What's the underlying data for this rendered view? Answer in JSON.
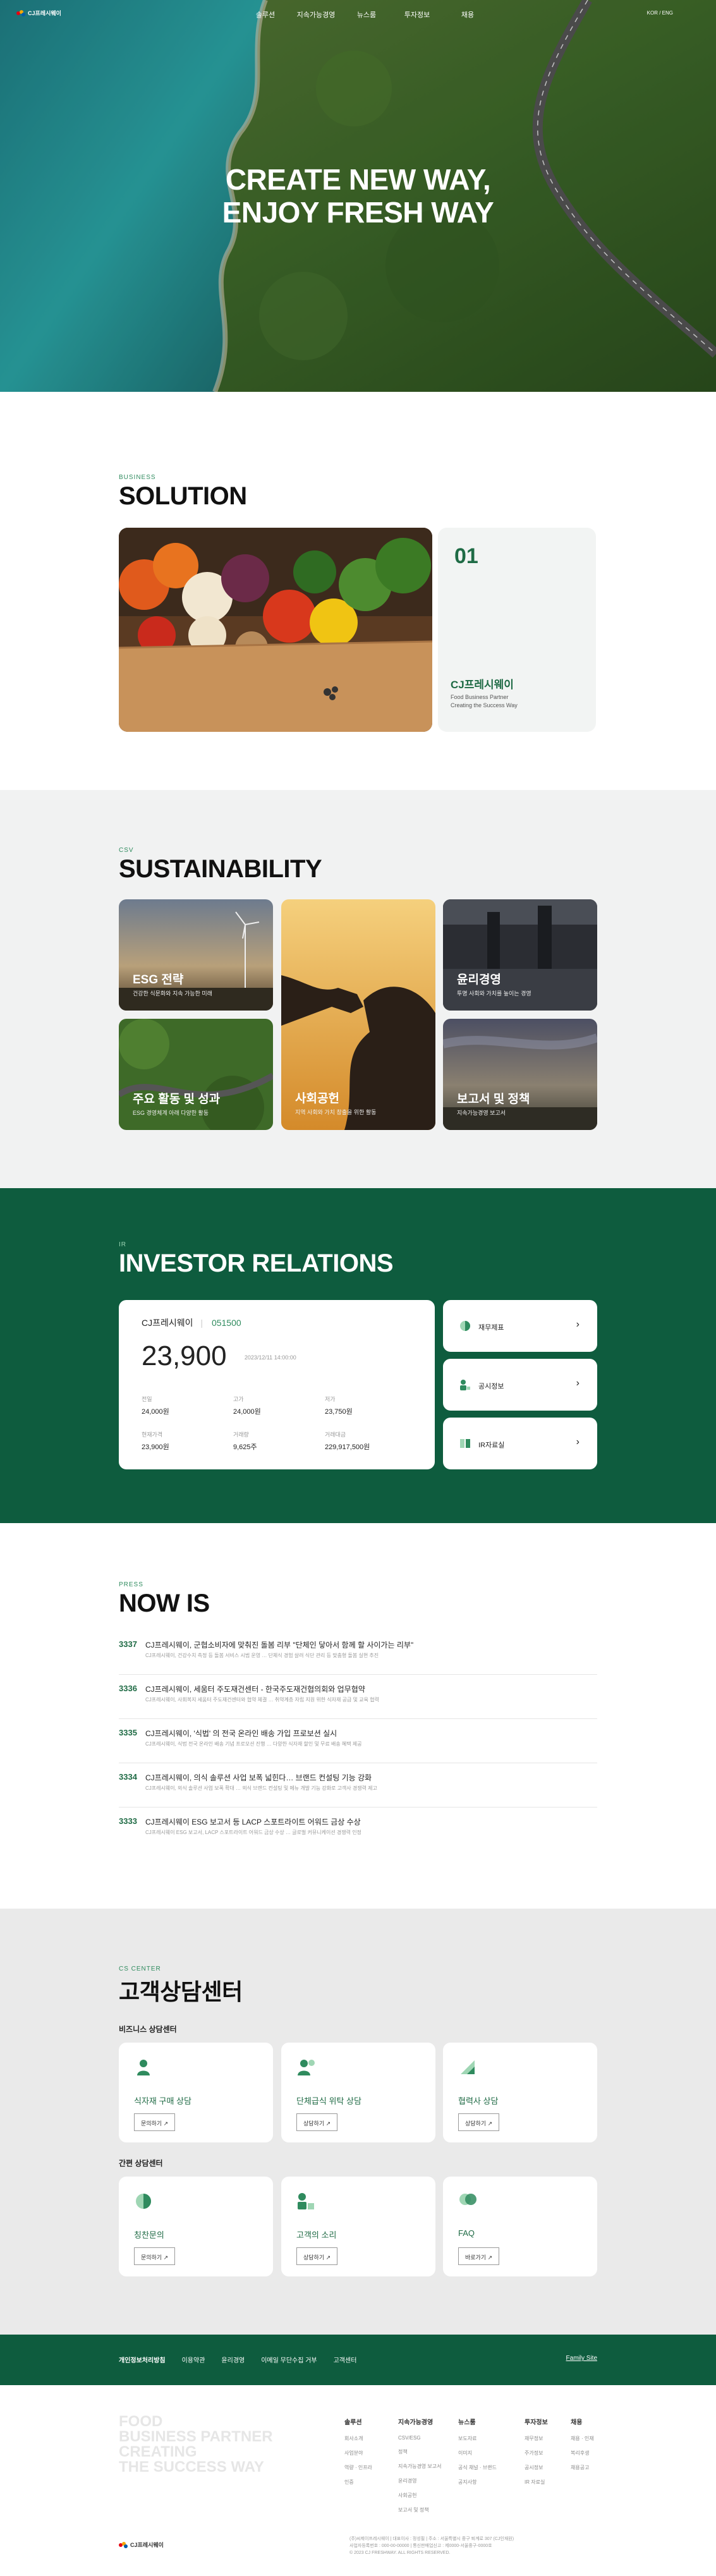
{
  "header": {
    "logo_text": "CJ프레시웨이",
    "nav": [
      "솔루션",
      "지속가능경영",
      "뉴스룸",
      "투자정보",
      "채용"
    ],
    "lang": "KOR / ENG"
  },
  "hero": {
    "line1": "CREATE NEW WAY,",
    "line2": "ENJOY FRESH WAY"
  },
  "solution": {
    "label": "BUSINESS",
    "title": "SOLUTION",
    "card": {
      "num": "01",
      "name": "CJ프레시웨이",
      "desc1": "Food Business Partner",
      "desc2": "Creating the Success Way"
    }
  },
  "sustainability": {
    "label": "CSV",
    "title": "SUSTAINABILITY",
    "tiles": [
      {
        "title": "ESG 전략",
        "desc": "건강한 식문화와 지속 가능한 미래"
      },
      {
        "title": "주요 활동 및 성과",
        "desc": "ESG 경영체계 아래 다양한 활동"
      },
      {
        "title": "사회공헌",
        "desc": "지역 사회와 가치 창출을 위한 활동"
      },
      {
        "title": "윤리경영",
        "desc": "투명 사회와 가치를 높이는 경영"
      },
      {
        "title": "보고서 및 정책",
        "desc": "지속가능경영 보고서"
      }
    ]
  },
  "investor": {
    "label": "IR",
    "title": "INVESTOR RELATIONS",
    "stock": {
      "name": "CJ프레시웨이",
      "code": "051500",
      "price": "23,900",
      "date": "2023/12/11 14:00:00",
      "cells": [
        {
          "k": "전일",
          "v": "24,000원"
        },
        {
          "k": "고가",
          "v": "24,000원"
        },
        {
          "k": "저가",
          "v": "23,750원"
        },
        {
          "k": "현재가격",
          "v": "23,900원"
        },
        {
          "k": "거래량",
          "v": "9,625주"
        },
        {
          "k": "거래대금",
          "v": "229,917,500원"
        }
      ]
    },
    "buttons": [
      "재무제표",
      "공시정보",
      "IR자료실"
    ]
  },
  "news": {
    "label": "PRESS",
    "title": "NOW IS",
    "rows": [
      {
        "no": "3337",
        "title": "CJ프레시웨이, 군협소비자에 맞춰진 돌봄 리부 \"단체인 닿아서 함께 할 사이가는 리부\"",
        "sub": "CJ프레시웨이, 건강수치 측정 등 돌봄 서비스 시범 운영 … 단체식 경험 살려 식단 관리 등 맞춤형 돌봄 실현 추진"
      },
      {
        "no": "3336",
        "title": "CJ프레시웨이, 세움터 주도재건센터 - 한국주도재건협의회와 업무협약",
        "sub": "CJ프레시웨이, 사회복지 세움터 주도재건센터와 협약 체결 … 취약계층 자립 지원 위한 식자재 공급 및 교육 협력"
      },
      {
        "no": "3335",
        "title": "CJ프레시웨이, '식법' 의 전국 온라인 배송 가입 프로보션 실시",
        "sub": "CJ프레시웨이, 식법 전국 온라인 배송 기념 프로모션 진행 … 다양한 식자재 할인 및 무료 배송 혜택 제공"
      },
      {
        "no": "3334",
        "title": "CJ프레시웨이, 의식 솔루션 사업 보폭 넓힌다… 브랜드 컨설팅 기능 강화",
        "sub": "CJ프레시웨이, 외식 솔루션 사업 보폭 확대 … 외식 브랜드 컨설팅 및 메뉴 개발 기능 강화로 고객사 경쟁력 제고"
      },
      {
        "no": "3333",
        "title": "CJ프레시웨이 ESG 보고서 등 LACP 스포트라이트 어워드 금상 수상",
        "sub": "CJ프레시웨이 ESG 보고서, LACP 스포트라이트 어워드 금상 수상 … 글로벌 커뮤니케이션 경쟁력 인정"
      }
    ]
  },
  "cs": {
    "label": "CS CENTER",
    "title": "고객상담센터",
    "biz_title": "비즈니스 상담센터",
    "simple_title": "간편 상담센터",
    "biz": [
      {
        "label": "식자재 구매 상담",
        "btn": "문의하기"
      },
      {
        "label": "단체급식 위탁 상담",
        "btn": "상담하기"
      },
      {
        "label": "협력사 상담",
        "btn": "상담하기"
      }
    ],
    "simple": [
      {
        "label": "칭찬문의",
        "btn": "문의하기"
      },
      {
        "label": "고객의 소리",
        "btn": "상담하기"
      },
      {
        "label": "FAQ",
        "btn": "바로가기"
      }
    ]
  },
  "footer": {
    "links": [
      "개인정보처리방침",
      "이용약관",
      "윤리경영",
      "이메일 무단수집 거부",
      "고객센터"
    ],
    "family": "Family Site",
    "slogan": [
      "FOOD",
      "BUSINESS PARTNER",
      "CREATING",
      "THE SUCCESS WAY"
    ],
    "cols": [
      {
        "h": "솔루션",
        "items": [
          "회사소개",
          "사업분야",
          "역량 · 인프라",
          "인증"
        ]
      },
      {
        "h": "지속가능경영",
        "items": [
          "CSV/ESG",
          "정책",
          "지속가능경영 보고서",
          "윤리경영",
          "사회공헌",
          "보고서 및 정책"
        ]
      },
      {
        "h": "뉴스룸",
        "items": [
          "보도자료",
          "이미지",
          "공식 채널 · 브랜드",
          "공지사항"
        ]
      },
      {
        "h": "투자정보",
        "items": [
          "재무정보",
          "주가정보",
          "공시정보",
          "IR 자료실"
        ]
      },
      {
        "h": "채용",
        "items": [
          "채용 · 인재",
          "복리후생",
          "채용공고"
        ]
      }
    ],
    "logo_text": "CJ프레시웨이",
    "info": [
      "(주)씨제이프레시웨이 | 대표이사 : 정성필 | 주소 : 서울특별시 중구 퇴계로 307 (CJ인재원)",
      "사업자등록번호 : 000-00-00000 | 통신판매업신고 : 제0000-서울중구-0000호",
      "© 2023 CJ FRESHWAY. ALL RIGHTS RESERVED."
    ]
  }
}
